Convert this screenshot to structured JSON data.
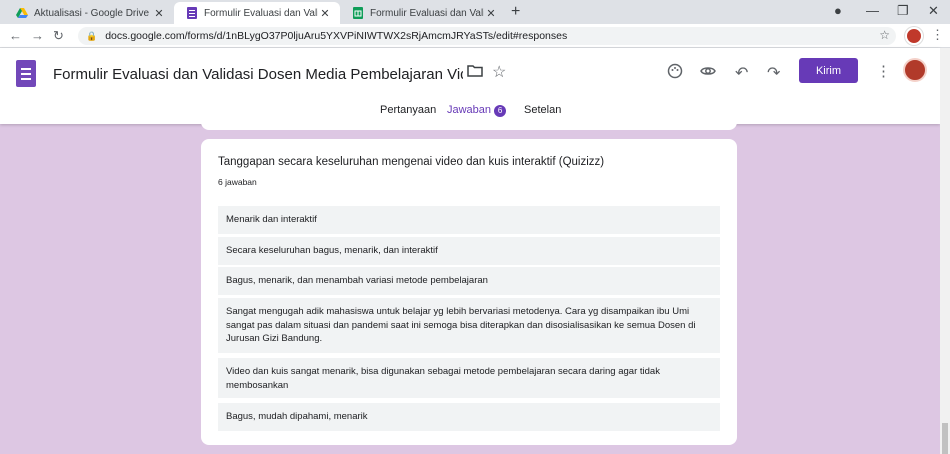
{
  "browser": {
    "tabs": [
      {
        "title": "Aktualisasi - Google Drive",
        "active": false
      },
      {
        "title": "Formulir Evaluasi dan Validasi Do",
        "active": true
      },
      {
        "title": "Formulir Evaluasi dan Validasi Do",
        "active": false
      }
    ],
    "url": "docs.google.com/forms/d/1nBLygO37P0ljuAru5YXVPiNIWTWX2sRjAmcmJRYaSTs/edit#responses"
  },
  "header": {
    "title": "Formulir Evaluasi dan Validasi Dosen Media Pembelajaran Video Berbasis I",
    "send_label": "Kirim",
    "tabs": {
      "questions": "Pertanyaan",
      "responses": "Jawaban",
      "responses_count": "6",
      "settings": "Setelan"
    }
  },
  "question": {
    "title": "Tanggapan secara keseluruhan mengenai video dan kuis interaktif (Quizizz)",
    "count": "6 jawaban",
    "responses": [
      "Menarik dan interaktif",
      "Secara keseluruhan bagus, menarik, dan interaktif",
      "Bagus, menarik, dan menambah variasi metode pembelajaran",
      "Sangat mengugah adik mahasiswa untuk belajar yg lebih bervariasi metodenya. Cara yg disampaikan ibu Umi sangat pas dalam situasi dan pandemi saat ini semoga bisa diterapkan dan disosialisasikan ke semua Dosen di Jurusan Gizi Bandung.",
      "Video dan kuis sangat menarik, bisa digunakan sebagai metode pembelajaran secara daring agar tidak membosankan",
      "Bagus, mudah dipahami, menarik"
    ]
  },
  "colors": {
    "accent": "#673ab7",
    "background": "#ddc7e3"
  }
}
